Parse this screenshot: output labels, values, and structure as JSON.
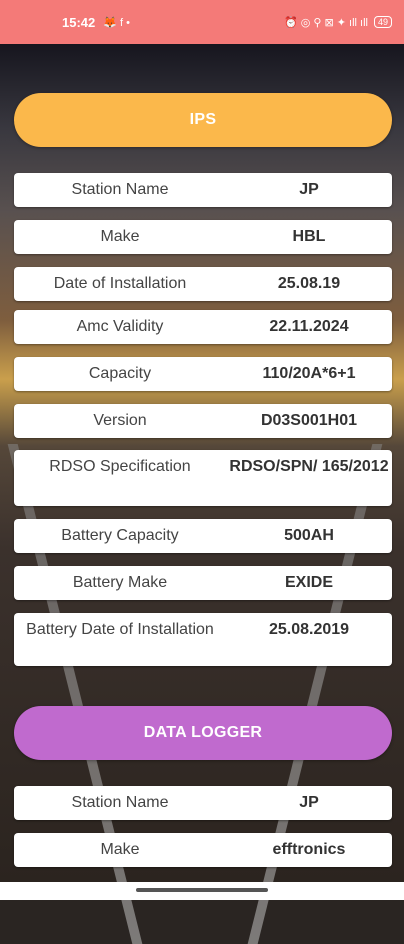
{
  "status_bar": {
    "time": "15:42",
    "notif_icons": "🦊 f •",
    "right_icons": "⏰ ◎ ⚲ ⊠ ✦ ıll ıll",
    "battery": "49"
  },
  "ips": {
    "title": "IPS",
    "rows": [
      {
        "label": "Station Name",
        "value": "JP"
      },
      {
        "label": "Make",
        "value": "HBL"
      },
      {
        "label": "Date of Installation",
        "value": "25.08.19"
      },
      {
        "label": "Amc Validity",
        "value": "22.11.2024"
      },
      {
        "label": "Capacity",
        "value": "110/20A*6+1"
      },
      {
        "label": "Version",
        "value": "D03S001H01"
      },
      {
        "label": "RDSO Specification",
        "value": "RDSO/SPN/ 165/2012"
      },
      {
        "label": "Battery Capacity",
        "value": "500AH"
      },
      {
        "label": "Battery Make",
        "value": "EXIDE"
      },
      {
        "label": "Battery Date of Installation",
        "value": "25.08.2019"
      }
    ]
  },
  "data_logger": {
    "title": "DATA LOGGER",
    "rows": [
      {
        "label": "Station Name",
        "value": "JP"
      },
      {
        "label": "Make",
        "value": "efftronics"
      }
    ]
  },
  "colors": {
    "status_bar": "#f47a78",
    "ips_button": "#fbb84b",
    "data_logger_button": "#c06ace"
  }
}
